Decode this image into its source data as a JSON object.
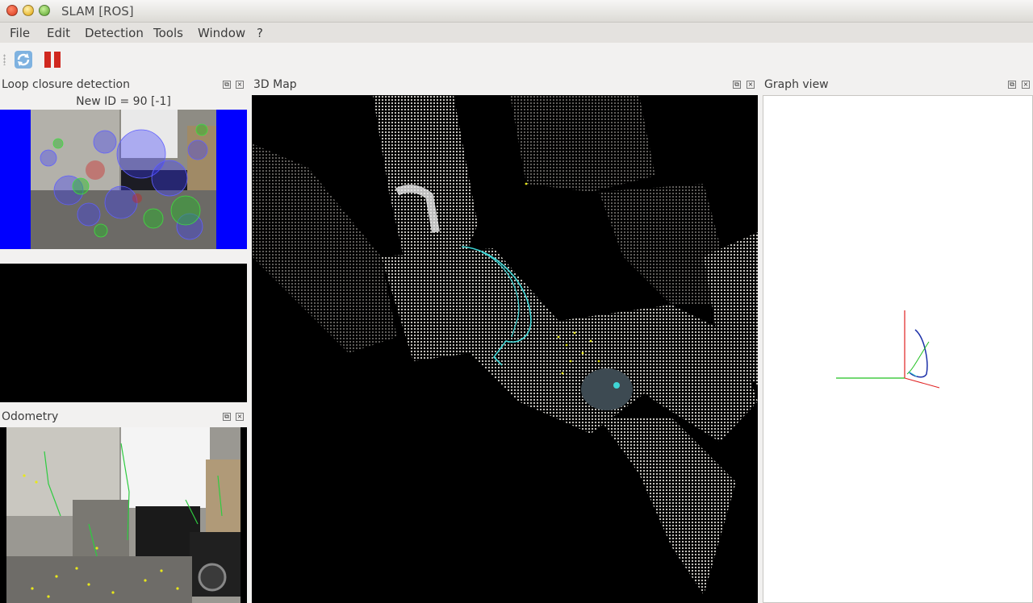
{
  "window": {
    "title": "SLAM [ROS]"
  },
  "menu": [
    "File",
    "Edit",
    "Detection",
    "Tools",
    "Window",
    "?"
  ],
  "toolbar": {
    "refresh_icon": "refresh-icon",
    "pause_icon": "pause-icon"
  },
  "panels": {
    "loop_closure": {
      "title": "Loop closure detection",
      "new_id_label": "New ID = 90 [-1]"
    },
    "map3d": {
      "title": "3D Map"
    },
    "graph": {
      "title": "Graph view"
    },
    "odometry": {
      "title": "Odometry"
    }
  },
  "colors": {
    "feature_blue": "#0000ff",
    "trajectory_cyan": "#3fd6d6",
    "feature_yellow": "#e8e81a",
    "feature_green": "#2ecc40"
  }
}
